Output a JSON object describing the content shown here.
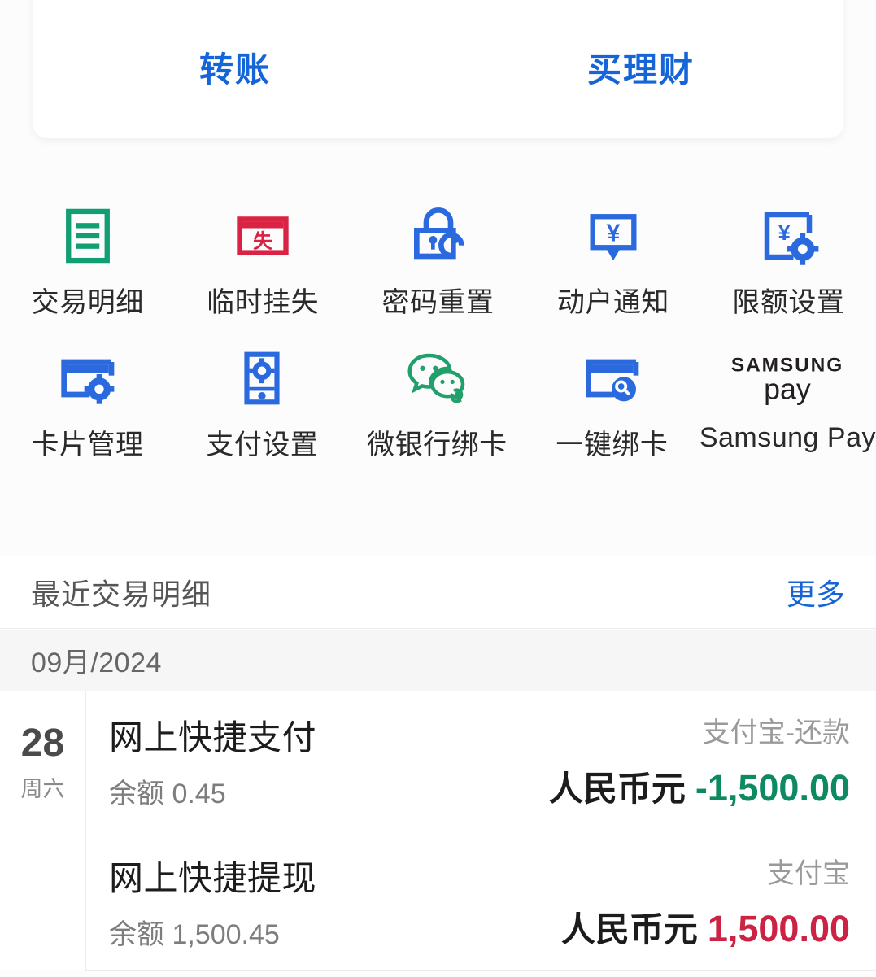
{
  "action_card": {
    "buttons": [
      {
        "label": "转账",
        "name": "transfer-button"
      },
      {
        "label": "买理财",
        "name": "buy-wealth-button"
      }
    ]
  },
  "quick_actions": {
    "rows": [
      [
        {
          "label": "交易明细",
          "icon": "transaction-details-icon",
          "color": "#109e72"
        },
        {
          "label": "临时挂失",
          "icon": "temporary-card-loss-icon",
          "color": "#d92244"
        },
        {
          "label": "密码重置",
          "icon": "password-reset-icon",
          "color": "#2a6ade"
        },
        {
          "label": "动户通知",
          "icon": "account-notification-icon",
          "color": "#2a6ade"
        },
        {
          "label": "限额设置",
          "icon": "limit-settings-icon",
          "color": "#2a6ade"
        }
      ],
      [
        {
          "label": "卡片管理",
          "icon": "card-management-icon",
          "color": "#2a6ade"
        },
        {
          "label": "支付设置",
          "icon": "payment-settings-icon",
          "color": "#2a6ade"
        },
        {
          "label": "微银行绑卡",
          "icon": "wechat-bind-card-icon",
          "color": "#22a06b"
        },
        {
          "label": "一键绑卡",
          "icon": "one-click-bind-card-icon",
          "color": "#2a6ade"
        },
        {
          "label": "Samsung Pay",
          "icon": "samsung-pay-icon",
          "color": "#231f20"
        }
      ]
    ]
  },
  "recent": {
    "title": "最近交易明细",
    "more_label": "更多",
    "month_label": "09月/2024",
    "transactions": [
      {
        "day": "28",
        "weekday": "周六",
        "name": "网上快捷支付",
        "balance": "余额 0.45",
        "channel": "支付宝-还款",
        "currency": "人民币元",
        "amount": "-1,500.00",
        "amount_color": "#0d8a62"
      },
      {
        "day": "",
        "weekday": "",
        "name": "网上快捷提现",
        "balance": "余额 1,500.45",
        "channel": "支付宝",
        "currency": "人民币元",
        "amount": "1,500.00",
        "amount_color": "#cc2244"
      }
    ]
  },
  "theme": {
    "accent_blue": "#1565d8",
    "page_bg": "#fcfcfc",
    "band_bg": "#f6f6f6",
    "divider": "#ececec"
  }
}
